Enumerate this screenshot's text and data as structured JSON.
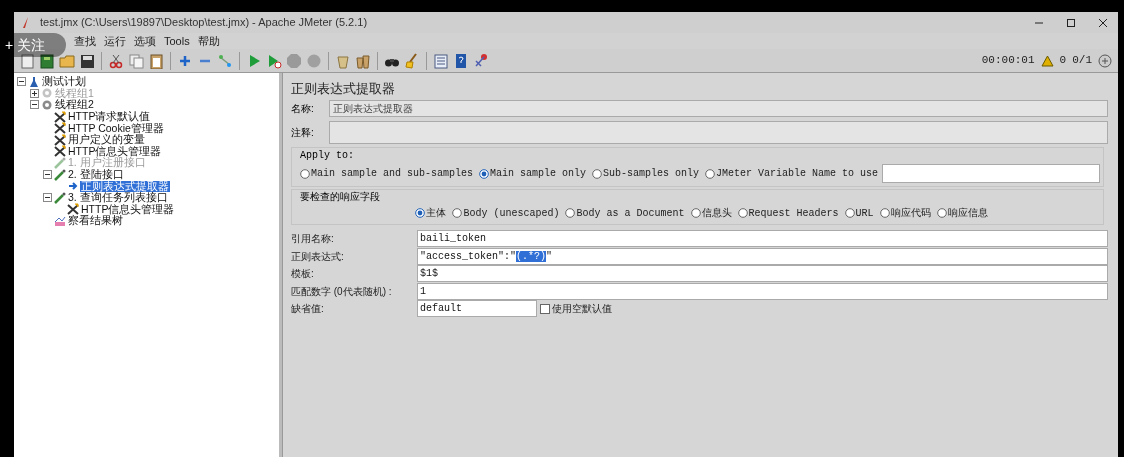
{
  "window": {
    "title": "test.jmx (C:\\Users\\19897\\Desktop\\test.jmx) - Apache JMeter (5.2.1)"
  },
  "overlay": {
    "follow_button": "+ 关注"
  },
  "menu": [
    "查找",
    "运行",
    "选项",
    "Tools",
    "帮助"
  ],
  "toolbar": [
    {
      "kind": "new"
    },
    {
      "kind": "templates"
    },
    {
      "kind": "open"
    },
    {
      "kind": "save"
    },
    {
      "kind": "cut"
    },
    {
      "kind": "copy"
    },
    {
      "kind": "paste"
    },
    {
      "kind": "expand"
    },
    {
      "kind": "collapse"
    },
    {
      "kind": "toggle"
    },
    {
      "kind": "start"
    },
    {
      "kind": "start-no-pause"
    },
    {
      "kind": "stop"
    },
    {
      "kind": "shutdown"
    },
    {
      "kind": "clear"
    },
    {
      "kind": "clear-all"
    },
    {
      "kind": "search"
    },
    {
      "kind": "reset-search"
    },
    {
      "kind": "function-helper"
    },
    {
      "kind": "help"
    },
    {
      "kind": "remote"
    }
  ],
  "status": {
    "timer": "00:00:01",
    "warnings": "0",
    "threads": "0/1"
  },
  "tree": [
    {
      "label": "测试计划",
      "kind": "plan",
      "expanded": true,
      "disabled": false,
      "selected": false,
      "children": [
        {
          "label": "线程组1",
          "kind": "thread",
          "expanded": false,
          "disabled": true,
          "selected": false
        },
        {
          "label": "线程组2",
          "kind": "thread",
          "expanded": true,
          "disabled": false,
          "selected": false,
          "children": [
            {
              "label": "HTTP请求默认值",
              "kind": "config",
              "disabled": false,
              "selected": false
            },
            {
              "label": "HTTP Cookie管理器",
              "kind": "config",
              "disabled": false,
              "selected": false
            },
            {
              "label": "用户定义的变量",
              "kind": "config",
              "disabled": false,
              "selected": false
            },
            {
              "label": "HTTP信息头管理器",
              "kind": "config",
              "disabled": false,
              "selected": false
            },
            {
              "label": "1. 用户注册接口",
              "kind": "sampler",
              "disabled": true,
              "selected": false
            },
            {
              "label": "2. 登陆接口",
              "kind": "sampler",
              "expanded": true,
              "disabled": false,
              "selected": false,
              "children": [
                {
                  "label": "正则表达式提取器",
                  "kind": "extractor",
                  "disabled": false,
                  "selected": true
                }
              ]
            },
            {
              "label": "3. 查询任务列表接口",
              "kind": "sampler",
              "expanded": true,
              "disabled": false,
              "selected": false,
              "children": [
                {
                  "label": "HTTP信息头管理器",
                  "kind": "config",
                  "disabled": false,
                  "selected": false
                }
              ]
            },
            {
              "label": "察看结果树",
              "kind": "listener",
              "disabled": false,
              "selected": false
            }
          ]
        }
      ]
    }
  ],
  "panel": {
    "title": "正则表达式提取器",
    "name_label": "名称:",
    "name_value": "正则表达式提取器",
    "comment_label": "注释:",
    "apply_to": {
      "legend": "Apply to:",
      "options": [
        {
          "label": "Main sample and sub-samples",
          "selected": false
        },
        {
          "label": "Main sample only",
          "selected": true
        },
        {
          "label": "Sub-samples only",
          "selected": false
        },
        {
          "label": "JMeter Variable Name to use",
          "selected": false
        }
      ]
    },
    "field_to_check": {
      "legend": "要检查的响应字段",
      "options": [
        {
          "label": "主体",
          "selected": true
        },
        {
          "label": "Body (unescaped)",
          "selected": false
        },
        {
          "label": "Body as a Document",
          "selected": false
        },
        {
          "label": "信息头",
          "selected": false
        },
        {
          "label": "Request Headers",
          "selected": false
        },
        {
          "label": "URL",
          "selected": false
        },
        {
          "label": "响应代码",
          "selected": false
        },
        {
          "label": "响应信息",
          "selected": false
        }
      ]
    },
    "fields": [
      {
        "label": "引用名称:",
        "value": "baili_token"
      },
      {
        "label": "正则表达式:",
        "value": "\"access_token\":\"",
        "selected_text": "(.*?)",
        "value_after": "\""
      },
      {
        "label": "模板:",
        "value": "$1$"
      },
      {
        "label": "匹配数字 (0代表随机) :",
        "value": "1"
      },
      {
        "label": "缺省值:",
        "value": "default",
        "checkbox": {
          "label": "使用空默认值",
          "checked": false
        }
      }
    ]
  }
}
